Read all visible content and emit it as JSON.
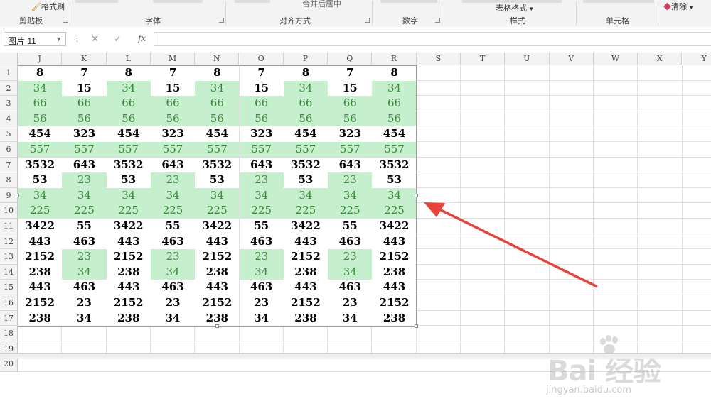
{
  "ribbon": {
    "format_painter_label": "格式刷",
    "groups": [
      "剪贴板",
      "字体",
      "对齐方式",
      "数字",
      "样式",
      "单元格"
    ],
    "table_format_label": "表格格式",
    "merge_center_label": "合并后居中",
    "clear_label": "清除"
  },
  "formula_bar": {
    "name_box": "图片 11",
    "fx_label": "fx",
    "formula": ""
  },
  "columns": [
    "J",
    "K",
    "L",
    "M",
    "N",
    "O",
    "P",
    "Q",
    "R",
    "S",
    "T",
    "U",
    "V",
    "W",
    "X",
    "Y"
  ],
  "rows": [
    {
      "num": "1",
      "cells": [
        "8",
        "7",
        "8",
        "7",
        "8",
        "7",
        "8",
        "7",
        "8"
      ]
    },
    {
      "num": "2",
      "cells": [
        "34",
        "15",
        "34",
        "15",
        "34",
        "15",
        "34",
        "15",
        "34"
      ]
    },
    {
      "num": "3",
      "cells": [
        "66",
        "66",
        "66",
        "66",
        "66",
        "66",
        "66",
        "66",
        "66"
      ]
    },
    {
      "num": "4",
      "cells": [
        "56",
        "56",
        "56",
        "56",
        "56",
        "56",
        "56",
        "56",
        "56"
      ]
    },
    {
      "num": "5",
      "cells": [
        "454",
        "323",
        "454",
        "323",
        "454",
        "323",
        "454",
        "323",
        "454"
      ]
    },
    {
      "num": "6",
      "cells": [
        "557",
        "557",
        "557",
        "557",
        "557",
        "557",
        "557",
        "557",
        "557"
      ]
    },
    {
      "num": "7",
      "cells": [
        "3532",
        "643",
        "3532",
        "643",
        "3532",
        "643",
        "3532",
        "643",
        "3532"
      ]
    },
    {
      "num": "8",
      "cells": [
        "53",
        "23",
        "53",
        "23",
        "53",
        "23",
        "53",
        "23",
        "53"
      ]
    },
    {
      "num": "9",
      "cells": [
        "34",
        "34",
        "34",
        "34",
        "34",
        "34",
        "34",
        "34",
        "34"
      ]
    },
    {
      "num": "10",
      "cells": [
        "225",
        "225",
        "225",
        "225",
        "225",
        "225",
        "225",
        "225",
        "225"
      ]
    },
    {
      "num": "11",
      "cells": [
        "3422",
        "55",
        "3422",
        "55",
        "3422",
        "55",
        "3422",
        "55",
        "3422"
      ]
    },
    {
      "num": "12",
      "cells": [
        "443",
        "463",
        "443",
        "463",
        "443",
        "463",
        "443",
        "463",
        "443"
      ]
    },
    {
      "num": "13",
      "cells": [
        "2152",
        "23",
        "2152",
        "23",
        "2152",
        "23",
        "2152",
        "23",
        "2152"
      ]
    },
    {
      "num": "14",
      "cells": [
        "238",
        "34",
        "238",
        "34",
        "238",
        "34",
        "238",
        "34",
        "238"
      ]
    },
    {
      "num": "15",
      "cells": [
        "443",
        "463",
        "443",
        "463",
        "443",
        "463",
        "443",
        "463",
        "443"
      ]
    },
    {
      "num": "16",
      "cells": [
        "2152",
        "23",
        "2152",
        "23",
        "2152",
        "23",
        "2152",
        "23",
        "2152"
      ]
    },
    {
      "num": "17",
      "cells": [
        "238",
        "34",
        "238",
        "34",
        "238",
        "34",
        "238",
        "34",
        "238"
      ]
    },
    {
      "num": "18",
      "cells": []
    },
    {
      "num": "19",
      "cells": []
    },
    {
      "num": "20",
      "cells": []
    }
  ],
  "highlight": {
    "fill": "#c6efce",
    "text_color": "#3a8a3a",
    "green_cells": [
      [
        2,
        0
      ],
      [
        2,
        2
      ],
      [
        2,
        4
      ],
      [
        2,
        6
      ],
      [
        2,
        8
      ],
      [
        3,
        0
      ],
      [
        3,
        1
      ],
      [
        3,
        2
      ],
      [
        3,
        3
      ],
      [
        3,
        4
      ],
      [
        3,
        5
      ],
      [
        3,
        6
      ],
      [
        3,
        7
      ],
      [
        3,
        8
      ],
      [
        4,
        0
      ],
      [
        4,
        1
      ],
      [
        4,
        2
      ],
      [
        4,
        3
      ],
      [
        4,
        4
      ],
      [
        4,
        5
      ],
      [
        4,
        6
      ],
      [
        4,
        7
      ],
      [
        4,
        8
      ],
      [
        6,
        0
      ],
      [
        6,
        1
      ],
      [
        6,
        2
      ],
      [
        6,
        3
      ],
      [
        6,
        4
      ],
      [
        6,
        5
      ],
      [
        6,
        6
      ],
      [
        6,
        7
      ],
      [
        6,
        8
      ],
      [
        8,
        1
      ],
      [
        8,
        3
      ],
      [
        8,
        5
      ],
      [
        8,
        7
      ],
      [
        9,
        0
      ],
      [
        9,
        1
      ],
      [
        9,
        2
      ],
      [
        9,
        3
      ],
      [
        9,
        4
      ],
      [
        9,
        5
      ],
      [
        9,
        6
      ],
      [
        9,
        7
      ],
      [
        9,
        8
      ],
      [
        10,
        0
      ],
      [
        10,
        1
      ],
      [
        10,
        2
      ],
      [
        10,
        3
      ],
      [
        10,
        4
      ],
      [
        10,
        5
      ],
      [
        10,
        6
      ],
      [
        10,
        7
      ],
      [
        10,
        8
      ],
      [
        13,
        1
      ],
      [
        13,
        3
      ],
      [
        13,
        5
      ],
      [
        13,
        7
      ],
      [
        14,
        1
      ],
      [
        14,
        3
      ],
      [
        14,
        5
      ],
      [
        14,
        7
      ]
    ]
  },
  "annotation": {
    "arrow_color": "#e8433a"
  },
  "watermark": {
    "brand": "Bai  经验",
    "url": "jingyan.baidu.com"
  }
}
